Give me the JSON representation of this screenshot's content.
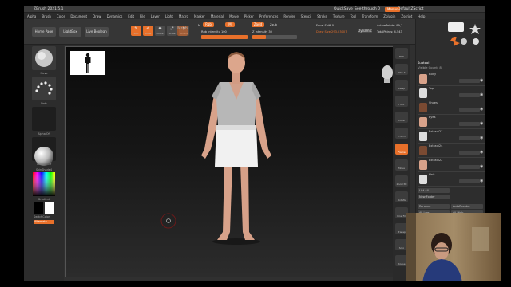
{
  "window": {
    "title": "ZBrush 2021.5.1",
    "quicksave": "QuickSave",
    "seethrough": "See-through 0",
    "menus_btn": "Menus",
    "script": "DefaultZScript"
  },
  "menubar": [
    "Alpha",
    "Brush",
    "Color",
    "Document",
    "Draw",
    "Dynamics",
    "Edit",
    "File",
    "Layer",
    "Light",
    "Macro",
    "Marker",
    "Material",
    "Movie",
    "Picker",
    "Preferences",
    "Render",
    "Stencil",
    "Stroke",
    "Texture",
    "Tool",
    "Transform",
    "Zplugin",
    "Zscript",
    "Help"
  ],
  "shelf": {
    "home_page": "Home Page",
    "lightbox": "LightBox",
    "live_boolean": "Live Boolean",
    "tools": [
      {
        "label": "Edit",
        "icon": "edit-icon",
        "active": true
      },
      {
        "label": "Draw",
        "icon": "draw-icon",
        "active": true
      },
      {
        "label": "Move",
        "icon": "move-icon",
        "active": false
      },
      {
        "label": "Scale",
        "icon": "scale-icon",
        "active": false
      },
      {
        "label": "Rotate",
        "icon": "rotate-icon",
        "active": false
      }
    ],
    "mrgb": "Mrgb",
    "rgb": "Rgb",
    "m": "M",
    "rgb_intensity": "Rgb Intensity 100",
    "zadd": "Zadd",
    "zsub": "Zsub",
    "z_intensity": "Z Intensity 30",
    "focal_shift": "Focal Shift 0",
    "draw_size": "Draw Size 293.03007",
    "dynamic": "Dynamic",
    "active_points": "ActivePoints: 99,7",
    "total_points": "TotalPoints: 4.543",
    "rgb_intensity_value": 1.0,
    "z_intensity_value": 0.3
  },
  "left": {
    "brush_label": "Move",
    "stroke_label": "Dots",
    "alpha_label": "Alpha Off",
    "texture_label": "Texture Off",
    "material_label": "SkinShade4",
    "gradient_label": "Gradient",
    "switch_label": "SwitchColor",
    "alternate_label": "Alternate"
  },
  "rightstrip": [
    "BPR",
    "SPix 3",
    "Persp",
    "Floor",
    "Local",
    "L.Sym",
    "Frame",
    "Move",
    "Zoom3D",
    "RotaTe",
    "Line Fill",
    "Transp",
    "Solo",
    "Xpose"
  ],
  "rightpanel": {
    "subtool_header": "Subtool",
    "visible_count": "Visible Count: 8",
    "subtools": [
      "Body",
      "Top",
      "Shoes",
      "Eyes",
      "Extract27",
      "Extract24",
      "Extract22",
      "Hair"
    ],
    "list_all": "List All",
    "new_folder": "New Folder",
    "rename": "Rename",
    "auto_reorder": "AutoReorder",
    "all_low": "All Low",
    "all_high": "All High",
    "copy": "Copy",
    "paste": "Paste",
    "duplicate": "Duplicate",
    "append": "Append"
  },
  "colors": {
    "accent": "#e8702a",
    "panel": "#303030",
    "canvas_top": "#0b0b0b",
    "canvas_bottom": "#2c2c2c",
    "skin": "#d9a48a",
    "shirt": "#b4b4b4",
    "skirt": "#f2f2f2"
  }
}
